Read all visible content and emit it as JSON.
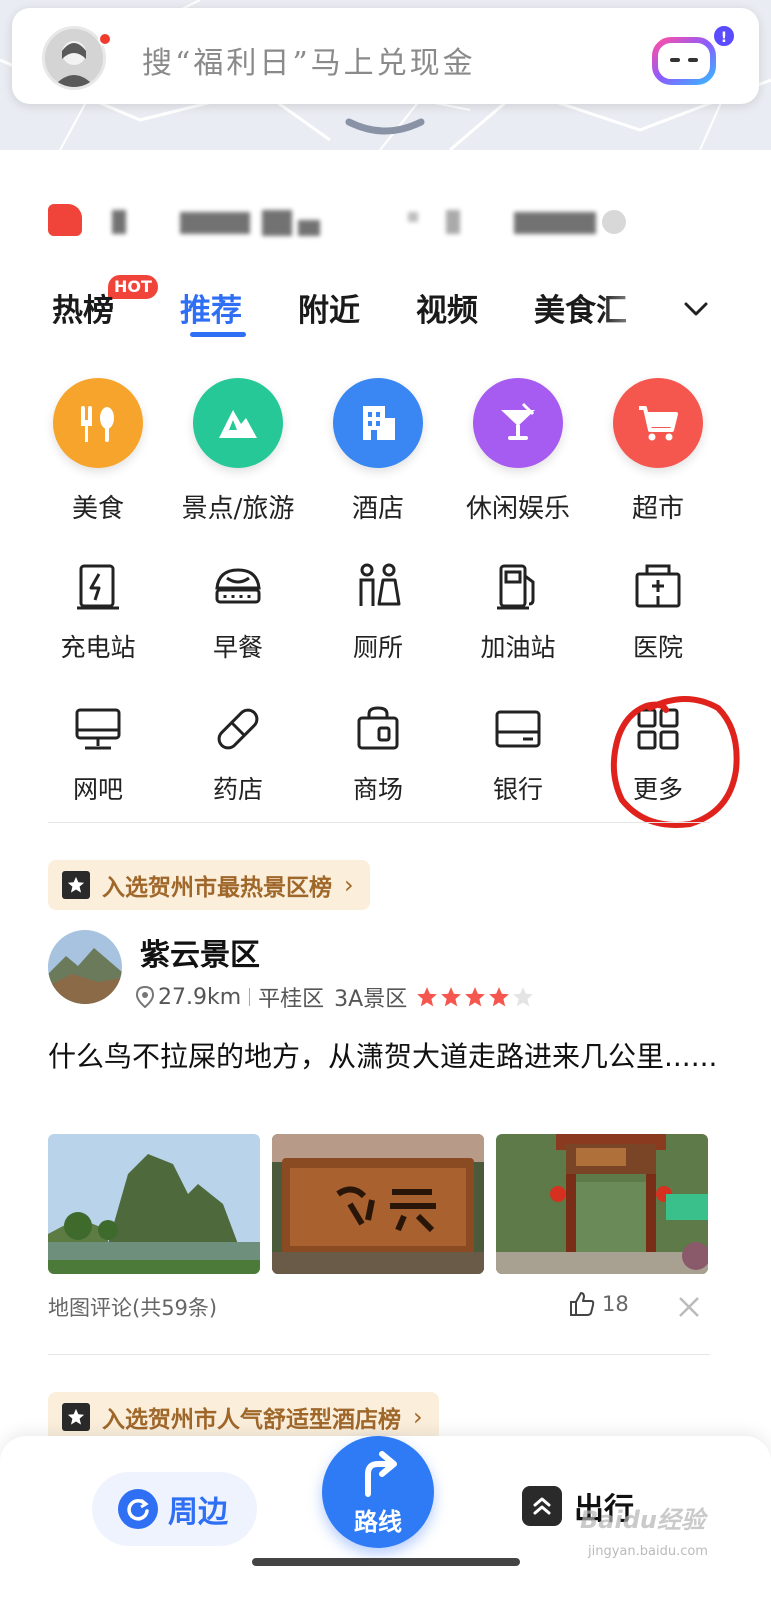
{
  "search": {
    "placeholder": "搜“福利日”马上兑现金",
    "assistant_badge": "!"
  },
  "tabs": {
    "hot_badge": "HOT",
    "items": [
      {
        "label": "热榜",
        "active": false
      },
      {
        "label": "推荐",
        "active": true
      },
      {
        "label": "附近",
        "active": false
      },
      {
        "label": "视频",
        "active": false
      },
      {
        "label": "美食汇",
        "active": false
      }
    ]
  },
  "categories": [
    {
      "label": "美食",
      "color": "#f7a42c",
      "icon": "fork-spoon-icon"
    },
    {
      "label": "景点/旅游",
      "color": "#27c897",
      "icon": "mountain-icon"
    },
    {
      "label": "酒店",
      "color": "#3a86f2",
      "icon": "building-icon"
    },
    {
      "label": "休闲娱乐",
      "color": "#a65cf0",
      "icon": "cocktail-icon"
    },
    {
      "label": "超市",
      "color": "#f5574f",
      "icon": "shopping-cart-icon"
    }
  ],
  "services_row1": [
    {
      "label": "充电站",
      "icon": "charging-station-icon"
    },
    {
      "label": "早餐",
      "icon": "bun-icon"
    },
    {
      "label": "厕所",
      "icon": "toilet-icon"
    },
    {
      "label": "加油站",
      "icon": "gas-pump-icon"
    },
    {
      "label": "医院",
      "icon": "hospital-icon"
    }
  ],
  "services_row2": [
    {
      "label": "网吧",
      "icon": "monitor-icon"
    },
    {
      "label": "药店",
      "icon": "pill-icon"
    },
    {
      "label": "商场",
      "icon": "shopping-bag-icon"
    },
    {
      "label": "银行",
      "icon": "bank-card-icon"
    },
    {
      "label": "更多",
      "icon": "grid-icon"
    }
  ],
  "card1": {
    "rank_tag": "入选贺州市最热景区榜",
    "name": "紫云景区",
    "distance": "27.9km",
    "district": "平桂区",
    "grade": "3A景区",
    "rating": 4,
    "review": "什么鸟不拉屎的地方，从潇贺大道走路进来几公里......",
    "review_count": "地图评论(共59条)",
    "likes": "18"
  },
  "card2": {
    "rank_tag": "入选贺州市人气舒适型酒店榜"
  },
  "bottom_nav": {
    "nearby": "周边",
    "route": "路线",
    "travel": "出行"
  },
  "watermark": {
    "main": "Baidu经验",
    "sub": "jingyan.baidu.com"
  },
  "colors": {
    "accent": "#2f6ff4",
    "hot": "#f0433a",
    "annotation": "#e0221c",
    "rank_bg": "#fbefdc",
    "rank_text": "#a0672a"
  }
}
